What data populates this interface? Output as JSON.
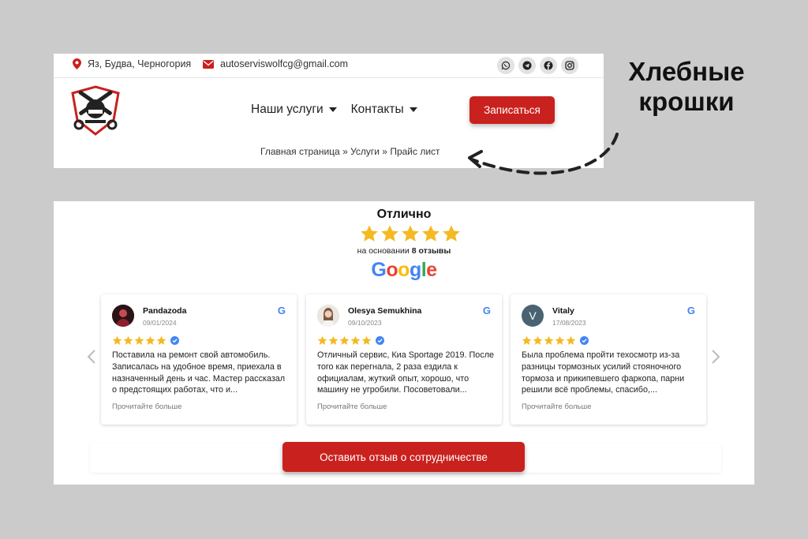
{
  "header": {
    "location": "Яз, Будва, Черногория",
    "email": "autoserviswolfcg@gmail.com",
    "socials": [
      "whatsapp-icon",
      "telegram-icon",
      "facebook-icon",
      "instagram-icon"
    ],
    "nav": [
      {
        "label": "Наши услуги"
      },
      {
        "label": "Контакты"
      }
    ],
    "book_button": "Записаться",
    "breadcrumb": "Главная страница » Услуги » Прайс лист"
  },
  "annotation": {
    "line1": "Хлебные",
    "line2": "крошки"
  },
  "reviews": {
    "rating_label": "Отлично",
    "stars": 5,
    "based_prefix": "на основании",
    "based_count": "8 отзывы",
    "google_logo": "Google",
    "items": [
      {
        "name": "Pandazoda",
        "date": "09/01/2024",
        "stars": 5,
        "text": "Поставила на ремонт свой автомобиль. Записалась на удобное время, приехала в назначенный день и час. Мастер рассказал о предстоящих работах, что и...",
        "more": "Прочитайте больше"
      },
      {
        "name": "Olesya Semukhina",
        "date": "09/10/2023",
        "stars": 5,
        "text": "Отличный сервис, Киа Sportage 2019. После того как перегнала, 2 раза ездила к официалам, жуткий опыт, хорошо, что машину не угробили. Посоветовали...",
        "more": "Прочитайте больше"
      },
      {
        "name": "Vitaly",
        "initial": "V",
        "date": "17/08/2023",
        "stars": 5,
        "text": "Была проблема пройти техосмотр из-за разницы тормозных усилий стояночного тормоза и прикипевшего фаркопа, парни решили всё проблемы, спасибо,...",
        "more": "Прочитайте больше"
      }
    ],
    "leave_button": "Оставить отзыв о сотрудничестве"
  },
  "colors": {
    "accent": "#c9211e",
    "star": "#f5b921",
    "background": "#cbcbcb"
  }
}
